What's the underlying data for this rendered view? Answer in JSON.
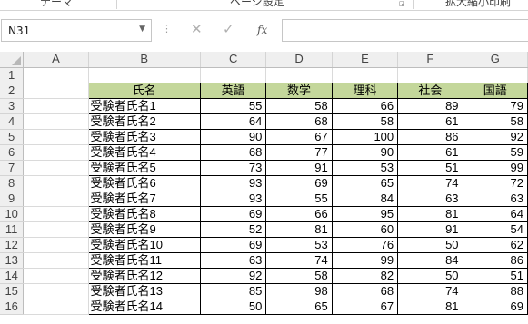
{
  "ribbon": {
    "groups": [
      "テーマ",
      "ページ設定",
      "拡大縮小印刷"
    ]
  },
  "formula_bar": {
    "name_box": "N31",
    "name_box_dropdown_icon": "chevron-down-icon",
    "more_icon": "vertical-dots-icon",
    "cancel_glyph": "✕",
    "enter_glyph": "✓",
    "function_glyph": "fx",
    "formula_value": ""
  },
  "sheet": {
    "columns": [
      "A",
      "B",
      "C",
      "D",
      "E",
      "F",
      "G"
    ],
    "rows": [
      "1",
      "2",
      "3",
      "4",
      "5",
      "6",
      "7",
      "8",
      "9",
      "10",
      "11",
      "12",
      "13",
      "14",
      "15",
      "16"
    ],
    "table_header": [
      "氏名",
      "英語",
      "数学",
      "理科",
      "社会",
      "国語"
    ],
    "header_color": "#c4d79b",
    "records": [
      [
        "受験者氏名1",
        "55",
        "58",
        "66",
        "89",
        "79"
      ],
      [
        "受験者氏名2",
        "64",
        "68",
        "58",
        "61",
        "58"
      ],
      [
        "受験者氏名3",
        "90",
        "67",
        "100",
        "86",
        "92"
      ],
      [
        "受験者氏名4",
        "68",
        "77",
        "90",
        "61",
        "59"
      ],
      [
        "受験者氏名5",
        "73",
        "91",
        "53",
        "51",
        "99"
      ],
      [
        "受験者氏名6",
        "93",
        "69",
        "65",
        "74",
        "72"
      ],
      [
        "受験者氏名7",
        "93",
        "55",
        "84",
        "63",
        "63"
      ],
      [
        "受験者氏名8",
        "69",
        "66",
        "95",
        "81",
        "64"
      ],
      [
        "受験者氏名9",
        "52",
        "81",
        "60",
        "91",
        "54"
      ],
      [
        "受験者氏名10",
        "69",
        "53",
        "76",
        "50",
        "62"
      ],
      [
        "受験者氏名11",
        "63",
        "74",
        "99",
        "84",
        "86"
      ],
      [
        "受験者氏名12",
        "92",
        "58",
        "82",
        "50",
        "51"
      ],
      [
        "受験者氏名13",
        "85",
        "98",
        "68",
        "74",
        "88"
      ],
      [
        "受験者氏名14",
        "50",
        "65",
        "67",
        "81",
        "69"
      ]
    ]
  }
}
